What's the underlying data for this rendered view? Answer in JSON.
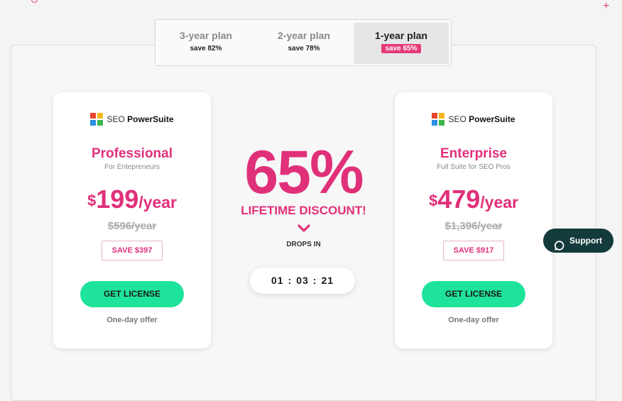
{
  "colors": {
    "accent": "#e0307a",
    "cta": "#1ee39a",
    "support_bg": "#143b3b"
  },
  "plan_switch": {
    "tabs": [
      {
        "label": "3-year plan",
        "save": "save 82%",
        "active": false
      },
      {
        "label": "2-year plan",
        "save": "save 78%",
        "active": false
      },
      {
        "label": "1-year plan",
        "save": "save 65%",
        "active": true
      }
    ]
  },
  "brand": {
    "prefix": "SEO ",
    "name": "PowerSuite"
  },
  "cards": [
    {
      "name": "Professional",
      "subtitle": "For Entepreneurs",
      "currency": "$",
      "price": "199",
      "period": "/year",
      "old_price": "$596/year",
      "save": "SAVE $397",
      "cta": "GET LICENSE",
      "offer": "One-day offer"
    },
    {
      "name": "Enterprise",
      "subtitle": "Full Suite for SEO Pros",
      "currency": "$",
      "price": "479",
      "period": "/year",
      "old_price": "$1,396/year",
      "save": "SAVE $917",
      "cta": "GET LICENSE",
      "offer": "One-day offer"
    }
  ],
  "discount": {
    "percent": "65%",
    "label": "LIFETIME DISCOUNT!",
    "drops_label": "DROPS IN",
    "icon": "chevron-down-icon"
  },
  "timer": {
    "hours": "01",
    "minutes": "03",
    "seconds": "21",
    "separator": ":"
  },
  "support": {
    "label": "Support",
    "icon": "chat-bubble-icon"
  }
}
